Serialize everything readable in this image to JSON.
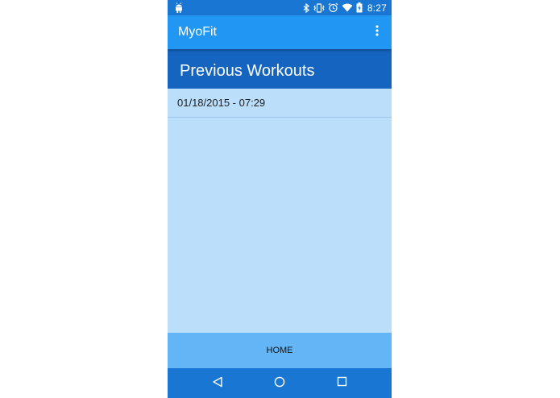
{
  "status_bar": {
    "time": "8:27",
    "battery_level": "charging",
    "icons": [
      "android-debug-icon",
      "bluetooth-icon",
      "vibrate-icon",
      "alarm-icon",
      "wifi-icon",
      "battery-charging-icon"
    ]
  },
  "app_bar": {
    "title": "MyoFit",
    "menu_icon": "overflow-menu-icon"
  },
  "section": {
    "title": "Previous Workouts"
  },
  "workouts": [
    {
      "label": "01/18/2015 - 07:29"
    }
  ],
  "home_button": {
    "label": "HOME"
  },
  "nav_bar": {
    "icons": [
      "back-icon",
      "home-circle-icon",
      "recents-icon"
    ]
  },
  "colors": {
    "status_bar": "#1976d2",
    "app_bar": "#2196f3",
    "section_header": "#1565c0",
    "list_background": "#bbdefb",
    "home_button": "#64b5f6",
    "nav_bar": "#1976d2"
  }
}
